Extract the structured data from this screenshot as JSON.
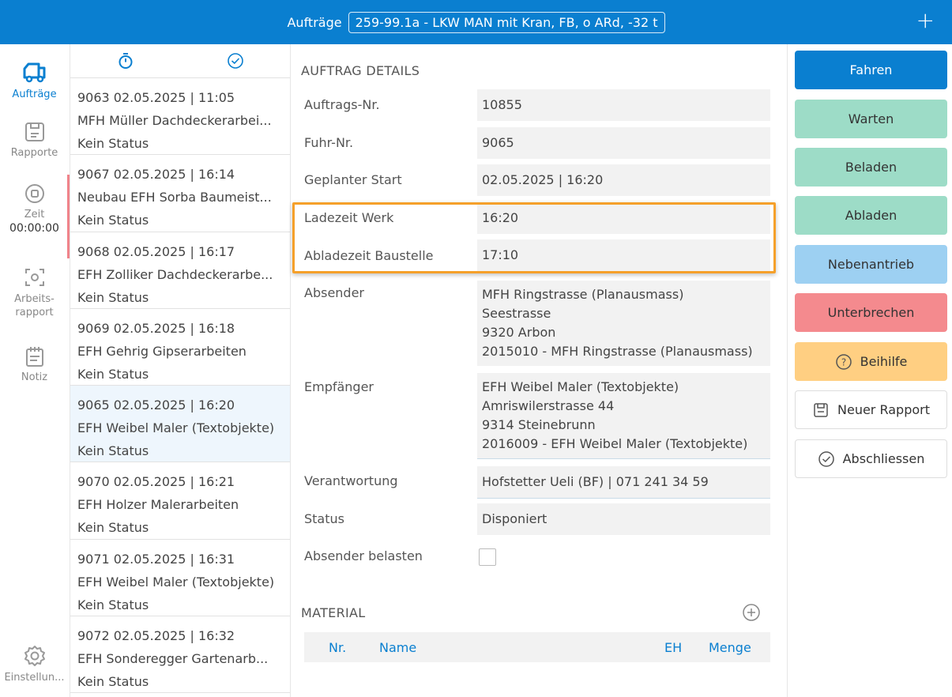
{
  "topbar": {
    "label": "Aufträge",
    "vehicle": "259-99.1a - LKW MAN mit Kran, FB, o ARd, -32 t",
    "add_icon": "plus-icon"
  },
  "nav": {
    "auftraege": "Aufträge",
    "rapporte": "Rapporte",
    "zeit": "Zeit",
    "timer": "00:00:00",
    "arbeitsrapport_1": "Arbeits-",
    "arbeitsrapport_2": "rapport",
    "notiz": "Notiz",
    "einstellungen": "Einstellun..."
  },
  "list": {
    "items": [
      {
        "line1": "9063  02.05.2025 | 11:05",
        "line2": "MFH Müller Dachdeckerarbei...",
        "line3": "Kein Status"
      },
      {
        "line1": "9067  02.05.2025 | 16:14",
        "line2": "Neubau EFH Sorba Baumeist...",
        "line3": "Kein Status"
      },
      {
        "line1": "9068  02.05.2025 | 16:17",
        "line2": "EFH Zolliker Dachdeckerarbe...",
        "line3": "Kein Status"
      },
      {
        "line1": "9069  02.05.2025 | 16:18",
        "line2": "EFH Gehrig Gipserarbeiten",
        "line3": "Kein Status"
      },
      {
        "line1": "9065  02.05.2025 | 16:20",
        "line2": "EFH Weibel Maler (Textobjekte)",
        "line3": "Kein Status"
      },
      {
        "line1": "9070  02.05.2025 | 16:21",
        "line2": "EFH Holzer Malerarbeiten",
        "line3": "Kein Status"
      },
      {
        "line1": "9071  02.05.2025 | 16:31",
        "line2": "EFH Weibel Maler (Textobjekte)",
        "line3": "Kein Status"
      },
      {
        "line1": "9072  02.05.2025 | 16:32",
        "line2": "EFH Sonderegger Gartenarb...",
        "line3": "Kein Status"
      }
    ]
  },
  "details": {
    "title": "AUFTRAG DETAILS",
    "auftrags_nr_label": "Auftrags-Nr.",
    "auftrags_nr": "10855",
    "fuhr_nr_label": "Fuhr-Nr.",
    "fuhr_nr": "9065",
    "start_label": "Geplanter Start",
    "start": "02.05.2025 | 16:20",
    "ladezeit_label": "Ladezeit Werk",
    "ladezeit": "16:20",
    "abladezeit_label": "Abladezeit Baustelle",
    "abladezeit": "17:10",
    "absender_label": "Absender",
    "absender": [
      "MFH Ringstrasse (Planausmass)",
      "Seestrasse",
      "9320 Arbon",
      "2015010 - MFH Ringstrasse (Planausmass)"
    ],
    "empfaenger_label": "Empfänger",
    "empfaenger": [
      "EFH Weibel Maler (Textobjekte)",
      "Amriswilerstrasse 44",
      "9314 Steinebrunn",
      "2016009 - EFH Weibel Maler (Textobjekte)"
    ],
    "verantwortung_label": "Verantwortung",
    "verantwortung": "Hofstetter Ueli (BF) | 071 241 34 59",
    "status_label": "Status",
    "status": "Disponiert",
    "belasten_label": "Absender belasten",
    "material_title": "MATERIAL",
    "material_cols": {
      "nr": "Nr.",
      "name": "Name",
      "eh": "EH",
      "menge": "Menge"
    }
  },
  "actions": {
    "fahren": "Fahren",
    "warten": "Warten",
    "beladen": "Beladen",
    "abladen": "Abladen",
    "nebenantrieb": "Nebenantrieb",
    "unterbrechen": "Unterbrechen",
    "beihilfe": "Beihilfe",
    "neuer_rapport": "Neuer Rapport",
    "abschliessen": "Abschliessen"
  },
  "colors": {
    "primary": "#0a7fd0",
    "green": "#9ddcc7",
    "lightblue": "#9dd0f2",
    "red": "#f48a8e",
    "orange": "#ffcf82",
    "highlight": "#f5a02a"
  }
}
